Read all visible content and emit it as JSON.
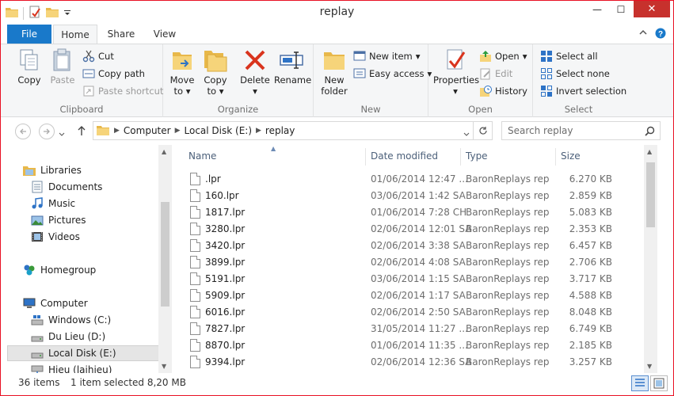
{
  "window": {
    "title": "replay",
    "close_glyph": "✕",
    "min_glyph": "—",
    "max_glyph": "☐"
  },
  "tabs": {
    "file": "File",
    "home": "Home",
    "share": "Share",
    "view": "View"
  },
  "ribbon": {
    "clipboard": {
      "label": "Clipboard",
      "copy": "Copy",
      "paste": "Paste",
      "cut": "Cut",
      "copy_path": "Copy path",
      "paste_shortcut": "Paste shortcut"
    },
    "organize": {
      "label": "Organize",
      "move_to": "Move",
      "move_to2": "to",
      "copy_to": "Copy",
      "copy_to2": "to",
      "delete": "Delete",
      "rename": "Rename"
    },
    "new": {
      "label": "New",
      "new_folder": "New",
      "new_folder2": "folder",
      "new_item": "New item",
      "easy_access": "Easy access"
    },
    "open": {
      "label": "Open",
      "properties": "Properties",
      "open": "Open",
      "edit": "Edit",
      "history": "History"
    },
    "select": {
      "label": "Select",
      "select_all": "Select all",
      "select_none": "Select none",
      "invert": "Invert selection"
    }
  },
  "address": {
    "path": [
      "Computer",
      "Local Disk (E:)",
      "replay"
    ]
  },
  "search": {
    "placeholder": "Search replay"
  },
  "navpane": {
    "libraries": "Libraries",
    "documents": "Documents",
    "music": "Music",
    "pictures": "Pictures",
    "videos": "Videos",
    "homegroup": "Homegroup",
    "computer": "Computer",
    "windows": "Windows (C:)",
    "dulieu": "Du Lieu (D:)",
    "localdisk": "Local Disk (E:)",
    "hieu": "Hieu (laihieu)"
  },
  "columns": {
    "name": "Name",
    "date": "Date modified",
    "type": "Type",
    "size": "Size"
  },
  "files": [
    {
      "name": ".lpr",
      "date": "01/06/2014 12:47 ...",
      "type": "BaronReplays repl...",
      "size": "6.270 KB"
    },
    {
      "name": "160.lpr",
      "date": "03/06/2014 1:42 SA",
      "type": "BaronReplays repl...",
      "size": "2.859 KB"
    },
    {
      "name": "1817.lpr",
      "date": "01/06/2014 7:28 CH",
      "type": "BaronReplays repl...",
      "size": "5.083 KB"
    },
    {
      "name": "3280.lpr",
      "date": "02/06/2014 12:01 SA",
      "type": "BaronReplays repl...",
      "size": "2.353 KB"
    },
    {
      "name": "3420.lpr",
      "date": "02/06/2014 3:38 SA",
      "type": "BaronReplays repl...",
      "size": "6.457 KB"
    },
    {
      "name": "3899.lpr",
      "date": "02/06/2014 4:08 SA",
      "type": "BaronReplays repl...",
      "size": "2.706 KB"
    },
    {
      "name": "5191.lpr",
      "date": "03/06/2014 1:15 SA",
      "type": "BaronReplays repl...",
      "size": "3.717 KB"
    },
    {
      "name": "5909.lpr",
      "date": "02/06/2014 1:17 SA",
      "type": "BaronReplays repl...",
      "size": "4.588 KB"
    },
    {
      "name": "6016.lpr",
      "date": "02/06/2014 2:50 SA",
      "type": "BaronReplays repl...",
      "size": "8.048 KB"
    },
    {
      "name": "7827.lpr",
      "date": "31/05/2014 11:27 ...",
      "type": "BaronReplays repl...",
      "size": "6.749 KB"
    },
    {
      "name": "8870.lpr",
      "date": "01/06/2014 11:35 ...",
      "type": "BaronReplays repl...",
      "size": "2.185 KB"
    },
    {
      "name": "9394.lpr",
      "date": "02/06/2014 12:36 SA",
      "type": "BaronReplays repl...",
      "size": "3.257 KB"
    }
  ],
  "status": {
    "count": "36 items",
    "selected": "1 item selected  8,20 MB"
  },
  "colors": {
    "accent": "#1979ca",
    "close": "#c7312d",
    "border": "#e81123"
  }
}
